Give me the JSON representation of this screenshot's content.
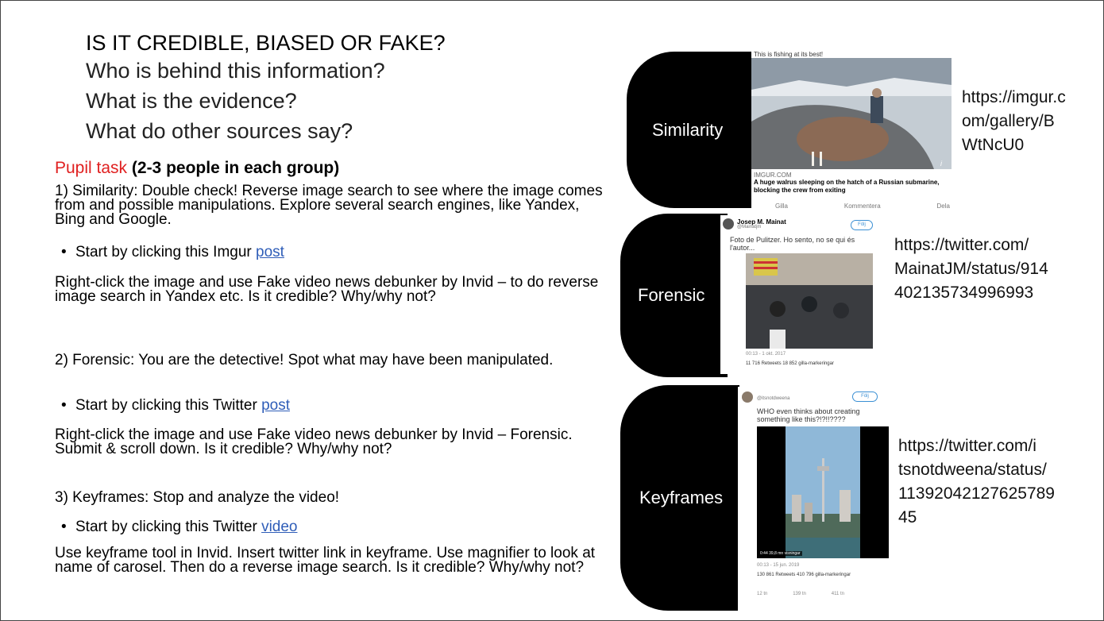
{
  "title": "IS IT CREDIBLE, BIASED OR FAKE?",
  "questions": [
    "Who is behind this information?",
    "What is the evidence?",
    "What do other sources say?"
  ],
  "task_label": "Pupil task",
  "task_group": "(2-3 people in each group)",
  "section1": {
    "text": "1) Similarity: Double check! Reverse image search to see where the image comes from and possible manipulations. Explore several search engines, like Yandex, Bing and Google.",
    "bullet_prefix": "Start by clicking this Imgur ",
    "link": "post",
    "instruction": "Right-click the image and use Fake video news debunker by Invid – to do reverse image search in Yandex etc. Is it credible? Why/why not?"
  },
  "section2": {
    "text": "2) Forensic: You are the detective! Spot what may have been manipulated.",
    "bullet_prefix": "Start by clicking this Twitter ",
    "link": "post",
    "instruction": "Right-click the image and use Fake video news debunker by Invid – Forensic. Submit & scroll down. Is it credible? Why/why not?"
  },
  "section3": {
    "text": "3) Keyframes: Stop and analyze the video!",
    "bullet_prefix": "Start by clicking this Twitter ",
    "link": "video",
    "instruction": "Use keyframe tool in Invid. Insert twitter link in keyframe. Use magnifier to look at name of carosel. Then do a reverse image search. Is it credible? Why/why not?"
  },
  "cards": {
    "similarity": {
      "label": "Similarity",
      "url_lines": [
        "https://imgur.c",
        "om/gallery/B",
        "WtNcU0"
      ],
      "caption_top": "This is fishing at its best!",
      "source": "IMGUR.COM",
      "headline": "A huge walrus sleeping on the hatch of a Russian submarine, blocking the crew from exiting",
      "actions": [
        "Gilla",
        "Kommentera",
        "Dela"
      ]
    },
    "forensic": {
      "label": "Forensic",
      "url_lines": [
        "https://twitter.com/",
        "MainatJM/status/914",
        "402135734996993"
      ],
      "author": "Josep M. Mainat",
      "handle": "@Mainatjm",
      "follow": "Följ",
      "tweet": "Foto de Pulitzer. Ho sento, no se qui és l'autor...",
      "time": "00:13 - 1 okt. 2017",
      "stats": "11 716 Retweets   18 852 gilla-markeringar"
    },
    "keyframes": {
      "label": "Keyframes",
      "url_lines": [
        "https://twitter.com/i",
        "tsnotdweena/status/",
        "11392042127625789",
        "45"
      ],
      "handle": "@itsnotdweena",
      "follow": "Följ",
      "tweet": "WHO even thinks about creating something like this?!?!!????",
      "video_time": "0:44",
      "video_views": "39,8 mn visningar",
      "time": "00:13 - 15 jun. 2019",
      "stats": "130 861 Retweets   410 796 gilla-markeringar",
      "actions": [
        "12 tn",
        "139 tn",
        "411 tn"
      ]
    }
  },
  "colors": {
    "accent_red": "#e02020",
    "link": "#2f5db8",
    "pill": "#000000"
  }
}
